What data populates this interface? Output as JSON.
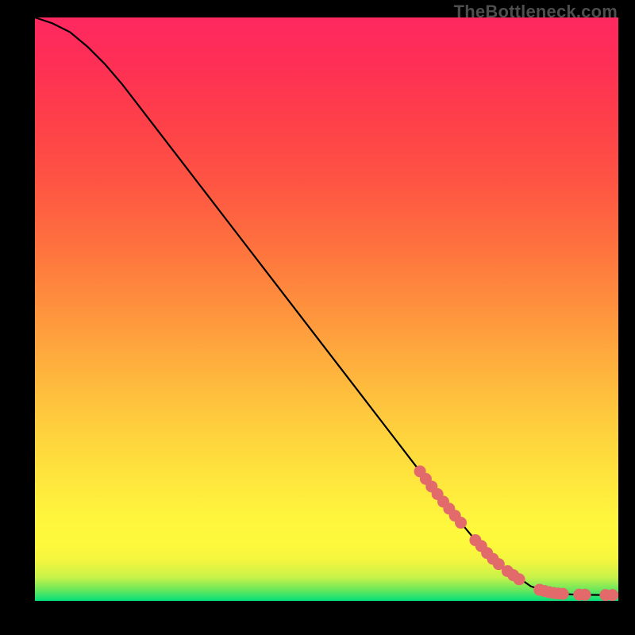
{
  "watermark": "TheBottleneck.com",
  "colors": {
    "background": "#000000",
    "curve": "#000000",
    "marker": "#e26a6a"
  },
  "chart_data": {
    "type": "line",
    "title": "",
    "xlabel": "",
    "ylabel": "",
    "xlim": [
      0,
      100
    ],
    "ylim": [
      0,
      100
    ],
    "grid": false,
    "series": [
      {
        "name": "curve",
        "x": [
          0,
          3,
          6,
          9,
          12,
          15,
          20,
          25,
          30,
          35,
          40,
          45,
          50,
          55,
          60,
          65,
          70,
          75,
          80,
          85,
          88,
          90,
          92,
          94,
          96,
          98,
          100
        ],
        "y": [
          100,
          99,
          97.5,
          95,
          92,
          88.5,
          82,
          75.5,
          69,
          62.5,
          56,
          49.5,
          43,
          36.5,
          30,
          23.5,
          17,
          11,
          6,
          2.5,
          1.5,
          1.2,
          1.1,
          1.05,
          1.02,
          1.0,
          1.0
        ]
      }
    ],
    "markers": [
      {
        "x": 66,
        "y": 22.2
      },
      {
        "x": 67,
        "y": 20.9
      },
      {
        "x": 68,
        "y": 19.6
      },
      {
        "x": 69,
        "y": 18.3
      },
      {
        "x": 70,
        "y": 17.0
      },
      {
        "x": 71,
        "y": 15.8
      },
      {
        "x": 72,
        "y": 14.6
      },
      {
        "x": 73,
        "y": 13.4
      },
      {
        "x": 75.5,
        "y": 10.4
      },
      {
        "x": 76.5,
        "y": 9.4
      },
      {
        "x": 77.5,
        "y": 8.2
      },
      {
        "x": 78.5,
        "y": 7.2
      },
      {
        "x": 79.5,
        "y": 6.3
      },
      {
        "x": 81.0,
        "y": 5.1
      },
      {
        "x": 82.0,
        "y": 4.4
      },
      {
        "x": 83.0,
        "y": 3.7
      },
      {
        "x": 86.5,
        "y": 1.9
      },
      {
        "x": 87.3,
        "y": 1.7
      },
      {
        "x": 88.1,
        "y": 1.5
      },
      {
        "x": 88.9,
        "y": 1.35
      },
      {
        "x": 89.7,
        "y": 1.25
      },
      {
        "x": 90.5,
        "y": 1.2
      },
      {
        "x": 93.3,
        "y": 1.07
      },
      {
        "x": 94.3,
        "y": 1.05
      },
      {
        "x": 97.8,
        "y": 1.0
      },
      {
        "x": 99.0,
        "y": 1.0
      }
    ]
  }
}
